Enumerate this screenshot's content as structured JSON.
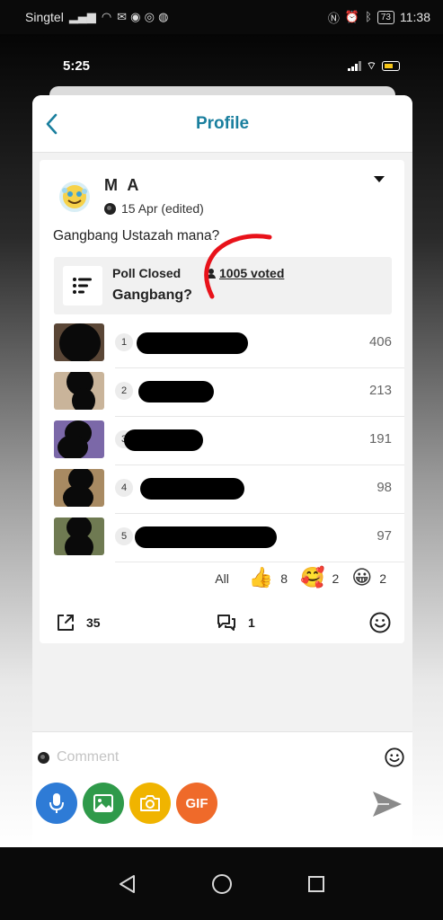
{
  "android_status": {
    "carrier": "Singtel",
    "battery": "73",
    "time": "11:38"
  },
  "ios_status": {
    "time": "5:25"
  },
  "nav": {
    "title": "Profile"
  },
  "post": {
    "author": "M A",
    "date": "15 Apr (edited)",
    "text": "Gangbang Ustazah mana?",
    "poll": {
      "status": "Poll Closed",
      "voted": "1005 voted",
      "question": "Gangbang?",
      "options": [
        {
          "number": "1",
          "count": "406"
        },
        {
          "number": "2",
          "count": "213"
        },
        {
          "number": "3",
          "count": "191"
        },
        {
          "number": "4",
          "count": "98"
        },
        {
          "number": "5",
          "count": "97"
        }
      ]
    },
    "reactions": {
      "all_label": "All",
      "items": [
        {
          "icon": "thumbs-up-icon",
          "emoji": "👍",
          "count": "8"
        },
        {
          "icon": "hearts-face-icon",
          "emoji": "🥰",
          "count": "2"
        },
        {
          "icon": "grin-face-icon",
          "emoji": "😀",
          "count": "2"
        }
      ]
    },
    "actions": {
      "share_count": "35",
      "comment_count": "1"
    }
  },
  "composer": {
    "placeholder": "Comment",
    "gif_label": "GIF",
    "colors": {
      "mic": "#2e7bd6",
      "image": "#2f9a4a",
      "camera": "#f0b400",
      "gif": "#ef6a2a"
    }
  },
  "colors": {
    "accent": "#1a7f9e",
    "annotation": "#e8121a"
  }
}
